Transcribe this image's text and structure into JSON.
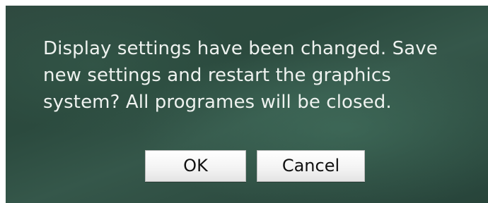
{
  "dialog": {
    "message": "Display settings have been changed. Save new settings and restart the graphics system? All programes will be closed.",
    "ok_label": "OK",
    "cancel_label": "Cancel"
  },
  "colors": {
    "dialog_background": "#2f4f43",
    "text": "#eef2ef",
    "button_background": "#f4f4f4"
  }
}
